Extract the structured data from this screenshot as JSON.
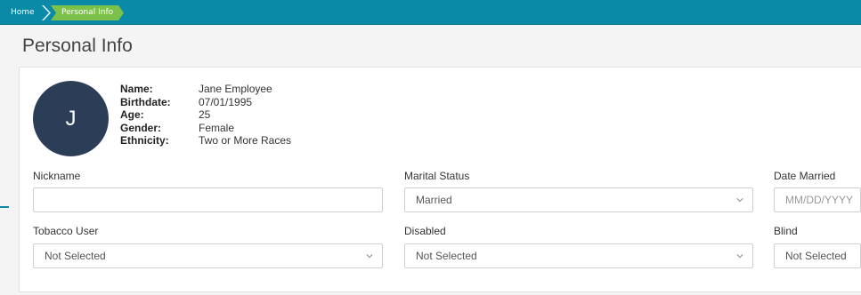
{
  "breadcrumb": {
    "home": "Home",
    "current": "Personal Info"
  },
  "page": {
    "title": "Personal Info"
  },
  "profile": {
    "avatar_initial": "J",
    "rows": [
      {
        "label": "Name:",
        "value": "Jane Employee"
      },
      {
        "label": "Birthdate:",
        "value": "07/01/1995"
      },
      {
        "label": "Age:",
        "value": "25"
      },
      {
        "label": "Gender:",
        "value": "Female"
      },
      {
        "label": "Ethnicity:",
        "value": "Two or More Races"
      }
    ]
  },
  "form": {
    "nickname": {
      "label": "Nickname",
      "value": ""
    },
    "marital_status": {
      "label": "Marital Status",
      "value": "Married"
    },
    "date_married": {
      "label": "Date Married",
      "placeholder": "MM/DD/YYYY"
    },
    "tobacco_user": {
      "label": "Tobacco User",
      "value": "Not Selected"
    },
    "disabled": {
      "label": "Disabled",
      "value": "Not Selected"
    },
    "blind": {
      "label": "Blind",
      "value": "Not Selected"
    }
  },
  "colors": {
    "header": "#0a8aa7",
    "breadcrumb_active": "#7cc24a",
    "avatar": "#2c3e57"
  },
  "icons": {
    "select_indicator": "chevron-down-icon"
  }
}
